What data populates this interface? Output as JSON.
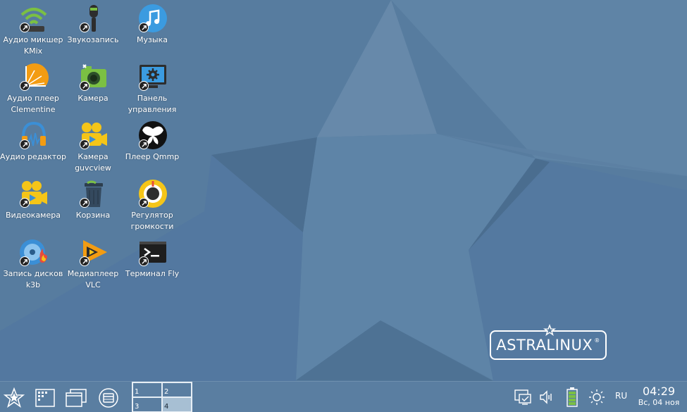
{
  "desktop": {
    "icons": [
      {
        "label": "Аудио микшер KMix",
        "icon": "audio-mixer-wifi-icon"
      },
      {
        "label": "Звукозапись",
        "icon": "microphone-icon"
      },
      {
        "label": "Музыка",
        "icon": "music-note-icon"
      },
      {
        "label": "Аудио плеер Clementine",
        "icon": "clementine-orange-icon"
      },
      {
        "label": "Камера",
        "icon": "camera-icon"
      },
      {
        "label": "Панель управления",
        "icon": "control-panel-gear-icon"
      },
      {
        "label": "Аудио редактор",
        "icon": "audio-editor-headphones-icon"
      },
      {
        "label": "Камера guvcview",
        "icon": "video-camera-icon"
      },
      {
        "label": "Плеер Qmmp",
        "icon": "qmmp-butterfly-icon"
      },
      {
        "label": "Видеокамера",
        "icon": "video-camera-icon"
      },
      {
        "label": "Корзина",
        "icon": "trash-icon"
      },
      {
        "label": "Регулятор громкости",
        "icon": "volume-knob-icon"
      },
      {
        "label": "Запись дисков k3b",
        "icon": "disc-burn-icon"
      },
      {
        "label": "Медиаплеер VLC",
        "icon": "vlc-play-icon"
      },
      {
        "label": "Терминал Fly",
        "icon": "terminal-icon"
      }
    ],
    "logo": {
      "text": "ASTRALINUX",
      "reg": "®"
    }
  },
  "taskbar": {
    "start": {
      "icon": "star-menu-icon"
    },
    "quick_launch": [
      {
        "icon": "app-grid-icon"
      },
      {
        "icon": "windows-stack-icon"
      },
      {
        "icon": "file-manager-icon"
      }
    ],
    "pager": [
      "1",
      "2",
      "3",
      "4"
    ],
    "pager_active": "4",
    "tray": {
      "icons": [
        "network-monitor-icon",
        "speaker-icon",
        "battery-icon",
        "brightness-icon"
      ],
      "lang": "RU",
      "time": "04:29",
      "date": "Вс, 04 ноя"
    }
  },
  "colors": {
    "desktop": "#577c9f",
    "taskbar": "#5a7ea1",
    "pager_active": "#a7bfd3"
  }
}
